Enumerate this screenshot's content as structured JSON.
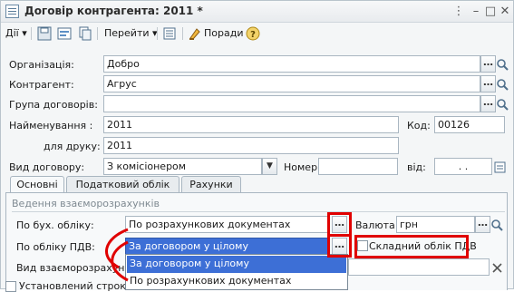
{
  "window": {
    "title": "Договір контрагента: 2011 *"
  },
  "toolbar": {
    "actions_label": "Дії",
    "goto_label": "Перейти",
    "tips_label": "Поради"
  },
  "form": {
    "organization": {
      "label": "Організація:",
      "value": "Добро"
    },
    "counterparty": {
      "label": "Контрагент:",
      "value": "Агрус"
    },
    "group": {
      "label": "Група договорів:",
      "value": ""
    },
    "name": {
      "label": "Найменування :",
      "value": "2011"
    },
    "code": {
      "label": "Код:",
      "value": "00126"
    },
    "print_name": {
      "label": "для друку:",
      "value": "2011"
    },
    "contract_type": {
      "label": "Вид договору:",
      "value": "З комісіонером"
    },
    "number": {
      "label": "Номер:",
      "value": ""
    },
    "date": {
      "label": "від:",
      "value": ". ."
    }
  },
  "tabs": [
    {
      "label": "Основні"
    },
    {
      "label": "Податковий облік"
    },
    {
      "label": "Рахунки"
    }
  ],
  "section": {
    "title": "Ведення взаєморозрахунків"
  },
  "settlements": {
    "accounting": {
      "label": "По бух. обліку:",
      "value": "По розрахункових документах"
    },
    "currency": {
      "label": "Валюта :",
      "value": "грн"
    },
    "vat": {
      "label": "По обліку ПДВ:",
      "value": "За договором у цілому"
    },
    "vat_complex": {
      "label": "Складний облік ПДВ"
    },
    "settlement_type": {
      "label": "Вид взаєморозрахун"
    },
    "fixed_term": {
      "label": "Установлений строк"
    }
  },
  "dropdown": {
    "options": [
      "За договором у цілому",
      "По розрахункових документах"
    ],
    "selected_index": 0
  },
  "colors": {
    "highlight": "#3d6fd6",
    "annotation_red": "#e00000"
  }
}
